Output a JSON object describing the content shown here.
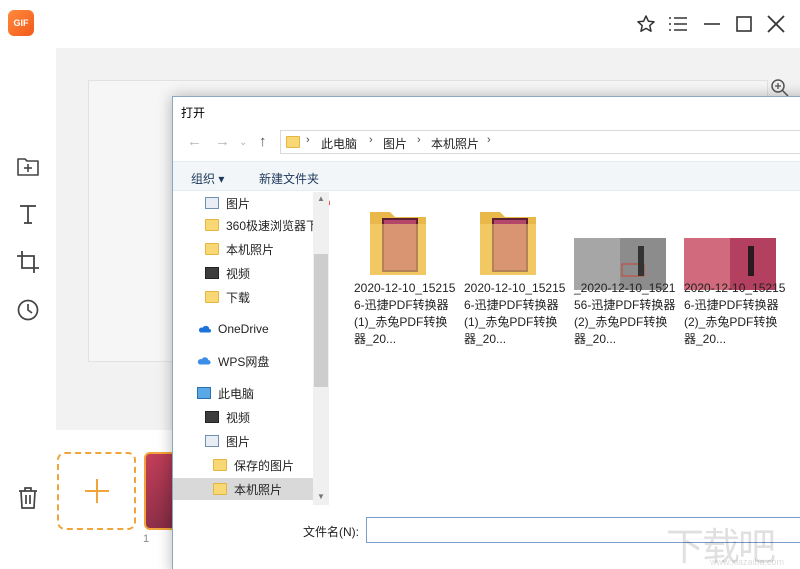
{
  "app": {
    "logo_text": "GIF",
    "accent": "#f0a43a",
    "frame_number": "1",
    "sidebar_icons": [
      "add-folder-icon",
      "text-icon",
      "crop-icon",
      "history-icon",
      "trash-icon"
    ],
    "window_controls": [
      "star-icon",
      "menu-icon",
      "minimize-icon",
      "maximize-icon",
      "close-icon"
    ]
  },
  "dialog": {
    "title": "打开",
    "breadcrumb": [
      "此电脑",
      "图片",
      "本机照片"
    ],
    "toolbar": {
      "organize": "组织 ▾",
      "new_folder": "新建文件夹"
    },
    "nav_items": [
      {
        "label": "图片",
        "icon": "pictures-icon"
      },
      {
        "label": "360极速浏览器下",
        "icon": "folder-icon"
      },
      {
        "label": "本机照片",
        "icon": "folder-icon"
      },
      {
        "label": "视频",
        "icon": "video-icon"
      },
      {
        "label": "下载",
        "icon": "folder-icon"
      },
      {
        "label": "OneDrive",
        "icon": "onedrive-icon"
      },
      {
        "label": "WPS网盘",
        "icon": "cloud-icon"
      },
      {
        "label": "此电脑",
        "icon": "computer-icon"
      },
      {
        "label": "视频",
        "icon": "video-icon"
      },
      {
        "label": "图片",
        "icon": "pictures-icon"
      },
      {
        "label": "保存的图片",
        "icon": "folder-icon"
      },
      {
        "label": "本机照片",
        "icon": "folder-icon"
      }
    ],
    "files": [
      {
        "name": "2020-12-10_152156-迅捷PDF转换器 (1)_赤兔PDF转换器_20...",
        "type": "folder"
      },
      {
        "name": "2020-12-10_152156-迅捷PDF转换器 (1)_赤兔PDF转换器_20...",
        "type": "folder"
      },
      {
        "name": "_2020-12-10_152156-迅捷PDF转换器 (2)_赤兔PDF转换器_20...",
        "type": "image-gray"
      },
      {
        "name": "2020-12-10_152156-迅捷PDF转换器 (2)_赤兔PDF转换器_20...",
        "type": "image-color"
      }
    ],
    "filename_label": "文件名(N):",
    "filename_value": ""
  },
  "watermark": {
    "main": "下载吧",
    "sub": "www.xiazaiba.com"
  }
}
